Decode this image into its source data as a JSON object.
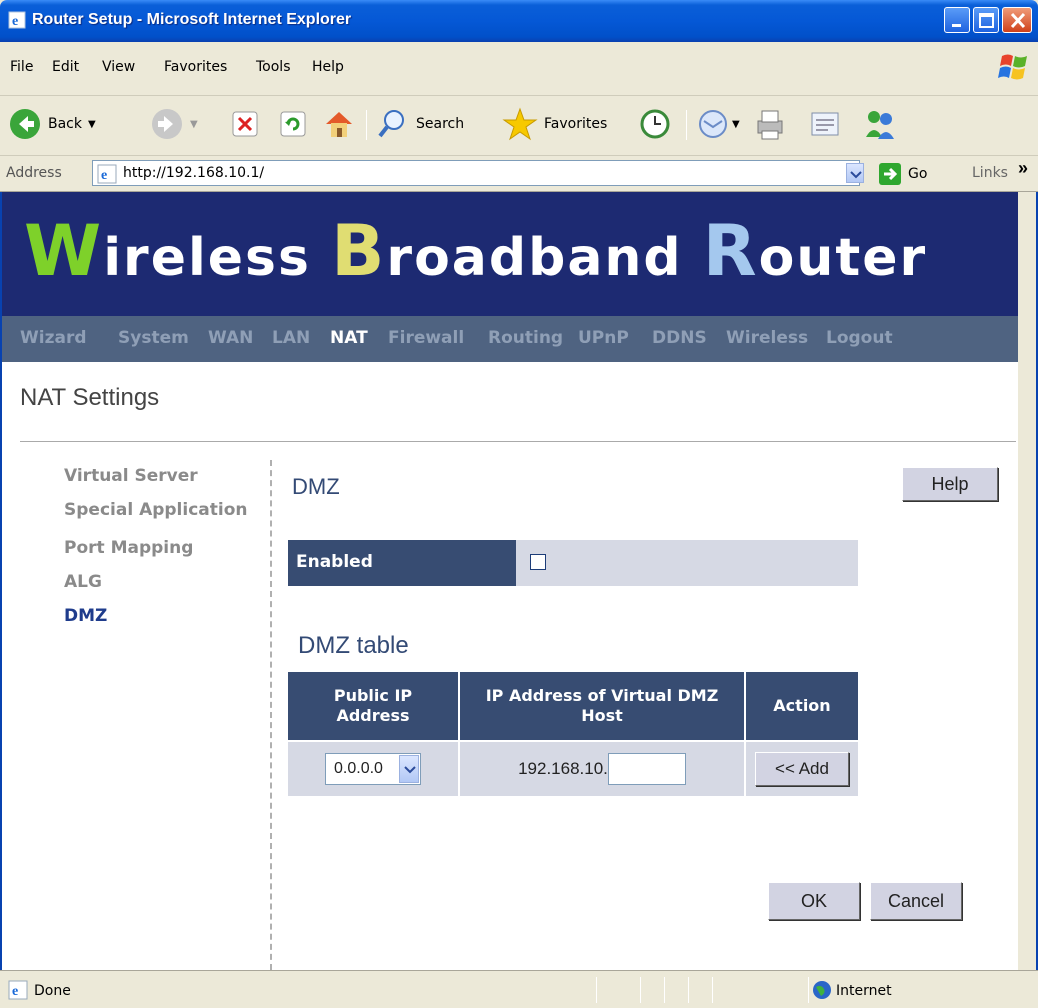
{
  "window": {
    "title": "Router Setup - Microsoft Internet Explorer"
  },
  "menu": [
    "File",
    "Edit",
    "View",
    "Favorites",
    "Tools",
    "Help"
  ],
  "toolbar": {
    "back": "Back",
    "search": "Search",
    "favorites": "Favorites"
  },
  "address": {
    "label": "Address",
    "url": "http://192.168.10.1/",
    "go": "Go",
    "links": "Links"
  },
  "banner": {
    "w_cap": "W",
    "w_rest": "ireless ",
    "b_cap": "B",
    "b_rest": "roadband ",
    "r_cap": "R",
    "r_rest": "outer"
  },
  "nav": [
    "Wizard",
    "System",
    "WAN",
    "LAN",
    "NAT",
    "Firewall",
    "Routing",
    "UPnP",
    "DDNS",
    "Wireless",
    "Logout"
  ],
  "page": {
    "heading": "NAT Settings"
  },
  "sidebar": [
    "Virtual Server",
    "Special Application",
    "Port Mapping",
    "ALG",
    "DMZ"
  ],
  "dmz": {
    "title": "DMZ",
    "help": "Help",
    "enabled_label": "Enabled",
    "enabled_checked": false,
    "table_title": "DMZ table",
    "headers": [
      "Public IP Address",
      "IP Address of Virtual DMZ Host",
      "Action"
    ],
    "public_ip_selected": "0.0.0.0",
    "host_prefix": "192.168.10.",
    "host_value": "",
    "add": "<< Add",
    "ok": "OK",
    "cancel": "Cancel"
  },
  "status": {
    "text": "Done",
    "zone": "Internet"
  },
  "colors": {
    "banner_bg": "#1d2a72",
    "navbar_bg": "#4f6381",
    "header_bg": "#374c72",
    "cell_bg": "#d6d9e4"
  }
}
